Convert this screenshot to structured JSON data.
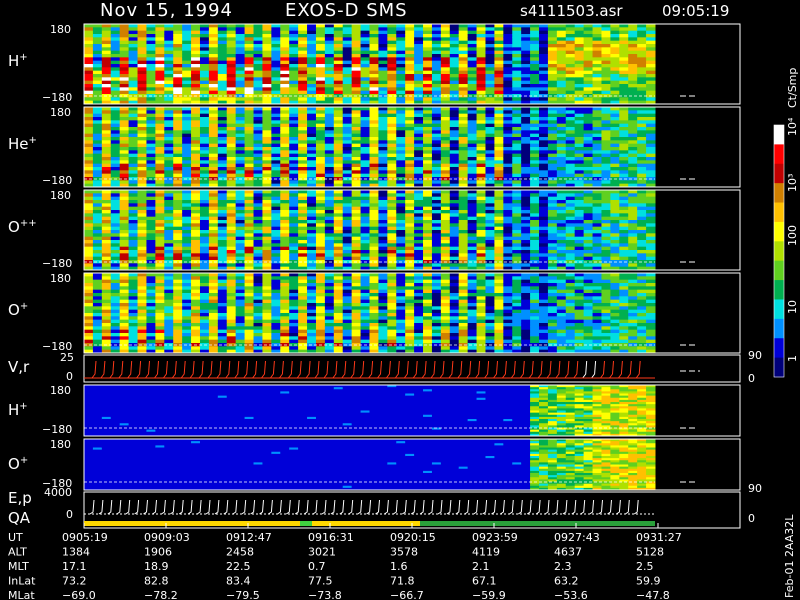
{
  "header": {
    "date": "Nov 15, 1994",
    "instrument": "EXOS-D SMS",
    "file": "s4111503.asr",
    "time": "09:05:19"
  },
  "colors": {
    "background": "#000000",
    "axis": "#ffffff",
    "vr_trace": "#ff3a1a",
    "ep_trace": "#ffffff"
  },
  "colorbar": {
    "unit": "Ct/Smp",
    "tick_labels": [
      "1",
      "10",
      "100",
      "10³",
      "10⁴"
    ],
    "stops": [
      "#00007a",
      "#0000d8",
      "#0090ff",
      "#00e0e0",
      "#00b050",
      "#60d020",
      "#b0e000",
      "#ffff00",
      "#ffc000",
      "#d08000",
      "#c00000",
      "#ff0000",
      "#ffffff"
    ]
  },
  "panels": [
    {
      "name": "H",
      "charge": "+",
      "ymax": "180",
      "ymin": "−180",
      "pattern": "H1"
    },
    {
      "name": "He",
      "charge": "+",
      "ymax": "180",
      "ymin": "−180",
      "pattern": "He"
    },
    {
      "name": "O",
      "charge": "++",
      "ymax": "180",
      "ymin": "−180",
      "pattern": "O2"
    },
    {
      "name": "O",
      "charge": "+",
      "ymax": "180",
      "ymin": "−180",
      "pattern": "O1"
    }
  ],
  "vr_panel": {
    "label": "V,r",
    "ymax": "25",
    "ymin": "0",
    "right_top": "90",
    "right_bottom": "0"
  },
  "lower_panels": [
    {
      "name": "H",
      "charge": "+",
      "ymax": "180",
      "ymin": "−180",
      "pattern": "H2"
    },
    {
      "name": "O",
      "charge": "+",
      "ymax": "180",
      "ymin": "−180",
      "pattern": "O3"
    }
  ],
  "ep_panel": {
    "label1": "E,p",
    "label2": "QA",
    "ymax": "4000",
    "ymin": "0",
    "right_top": "90",
    "right_bottom": "0"
  },
  "footer_id": "Feb-01 2AA32L",
  "chart_data": {
    "type": "heatmap",
    "title": "Nov 15, 1994   EXOS-D SMS",
    "colorbar_label": "Ct/Smp",
    "colorbar_scale": "log",
    "colorbar_range": [
      1,
      10000
    ],
    "y_range": [
      -180,
      180
    ],
    "vr_range": [
      0,
      25
    ],
    "ep_range": [
      0,
      4000
    ],
    "x_tick_labels": [
      "0905:19",
      "0909:03",
      "0912:47",
      "0916:31",
      "0920:15",
      "0923:59",
      "0927:43",
      "0931:27"
    ],
    "ephemeris": [
      {
        "label": "UT",
        "values": [
          "0905:19",
          "0909:03",
          "0912:47",
          "0916:31",
          "0920:15",
          "0923:59",
          "0927:43",
          "0931:27"
        ]
      },
      {
        "label": "ALT",
        "values": [
          "1384",
          "1906",
          "2458",
          "3021",
          "3578",
          "4119",
          "4637",
          "5128"
        ]
      },
      {
        "label": "MLT",
        "values": [
          "17.1",
          "18.9",
          "22.5",
          "0.7",
          "1.6",
          "2.1",
          "2.3",
          "2.5"
        ]
      },
      {
        "label": "InLat",
        "values": [
          "73.2",
          "82.8",
          "83.4",
          "77.5",
          "71.8",
          "67.1",
          "63.2",
          "59.9"
        ]
      },
      {
        "label": "MLat",
        "values": [
          "−69.0",
          "−78.2",
          "−79.5",
          "−73.8",
          "−66.7",
          "−59.9",
          "−53.6",
          "−47.8"
        ]
      }
    ]
  }
}
